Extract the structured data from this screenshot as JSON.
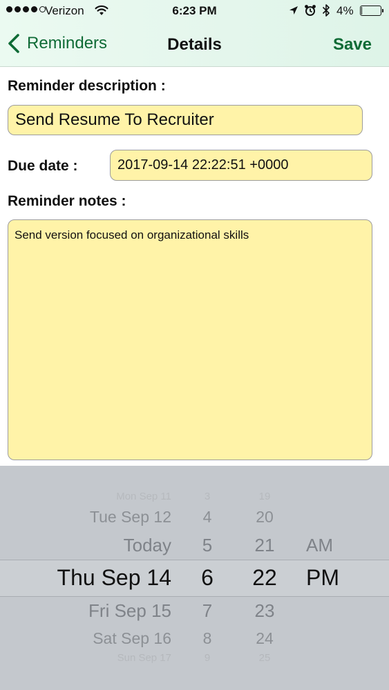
{
  "status_bar": {
    "carrier": "Verizon",
    "time": "6:23 PM",
    "battery_text": "4%",
    "battery_level": 0.04,
    "signal_bars_filled": 4,
    "icons": [
      "wifi-icon",
      "location-arrow-icon",
      "alarm-clock-icon",
      "bluetooth-icon",
      "battery-icon"
    ]
  },
  "nav": {
    "back_label": "Reminders",
    "title": "Details",
    "save_label": "Save",
    "accent_color": "#0f6b36"
  },
  "form": {
    "description_label": "Reminder description :",
    "description_value": "Send Resume To Recruiter",
    "due_date_label": "Due date :",
    "due_date_value": "2017-09-14 22:22:51 +0000",
    "notes_label": "Reminder notes :",
    "notes_value": "Send version focused on organizational skills",
    "field_color": "#fff3a8"
  },
  "picker": {
    "date": {
      "above": [
        "Mon Sep 11",
        "Tue Sep 12",
        "Today"
      ],
      "selected": "Thu Sep 14",
      "below": [
        "Fri Sep 15",
        "Sat Sep 16",
        "Sun Sep 17"
      ]
    },
    "hour": {
      "above": [
        "3",
        "4",
        "5"
      ],
      "selected": "6",
      "below": [
        "7",
        "8",
        "9"
      ]
    },
    "minute": {
      "above": [
        "19",
        "20",
        "21"
      ],
      "selected": "22",
      "below": [
        "23",
        "24",
        "25"
      ]
    },
    "period": {
      "above": "AM",
      "selected": "PM"
    }
  }
}
